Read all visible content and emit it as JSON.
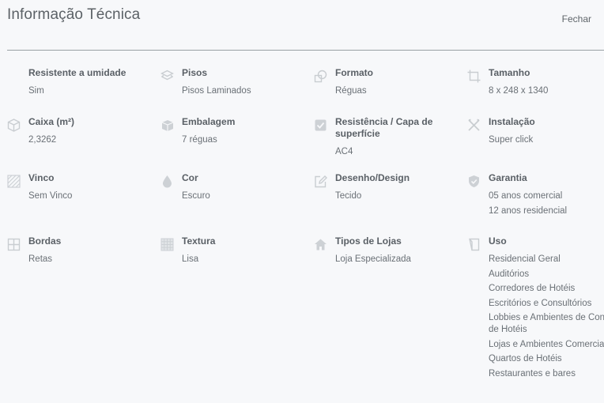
{
  "header": {
    "title": "Informação Técnica",
    "close_label": "Fechar"
  },
  "items": [
    {
      "label": "Resistente a umidade",
      "values": [
        "Sim"
      ],
      "icon": "none"
    },
    {
      "label": "Pisos",
      "values": [
        "Pisos Laminados"
      ],
      "icon": "layers-icon"
    },
    {
      "label": "Formato",
      "values": [
        "Réguas"
      ],
      "icon": "shapes-icon"
    },
    {
      "label": "Tamanho",
      "values": [
        "8 x 248 x 1340"
      ],
      "icon": "crop-frame-icon"
    },
    {
      "label": "Caixa (m²)",
      "values": [
        "2,3262"
      ],
      "icon": "box-icon"
    },
    {
      "label": "Embalagem",
      "values": [
        "7 réguas"
      ],
      "icon": "package-icon"
    },
    {
      "label": "Resistência / Capa de superfície",
      "values": [
        "AC4"
      ],
      "icon": "shield-check-icon"
    },
    {
      "label": "Instalação",
      "values": [
        "Super click"
      ],
      "icon": "tools-icon"
    },
    {
      "label": "Vinco",
      "values": [
        "Sem Vinco"
      ],
      "icon": "hatch-pattern-icon"
    },
    {
      "label": "Cor",
      "values": [
        "Escuro"
      ],
      "icon": "drop-icon"
    },
    {
      "label": "Desenho/Design",
      "values": [
        "Tecido"
      ],
      "icon": "pencil-square-icon"
    },
    {
      "label": "Garantia",
      "values": [
        "05 anos comercial",
        "12 anos residencial"
      ],
      "icon": "shield-icon"
    },
    {
      "label": "Bordas",
      "values": [
        "Retas"
      ],
      "icon": "grid-square-icon"
    },
    {
      "label": "Textura",
      "values": [
        "Lisa"
      ],
      "icon": "texture-grid-icon"
    },
    {
      "label": "Tipos de Lojas",
      "values": [
        "Loja Especializada"
      ],
      "icon": "house-icon"
    },
    {
      "label": "Uso",
      "values": [
        "Residencial Geral",
        "Auditórios",
        "Corredores de Hotéis",
        "Escritórios e Consultórios",
        "Lobbies e Ambientes de Convívio de Hotéis",
        "Lojas e Ambientes Comerciais",
        "Quartos de Hotéis",
        "Restaurantes e bares"
      ],
      "icon": "document-corner-icon"
    }
  ],
  "colors": {
    "background": "#f7f8fa",
    "text": "#555b61",
    "icon": "#cdd1d5",
    "divider": "#9aa0a5"
  }
}
